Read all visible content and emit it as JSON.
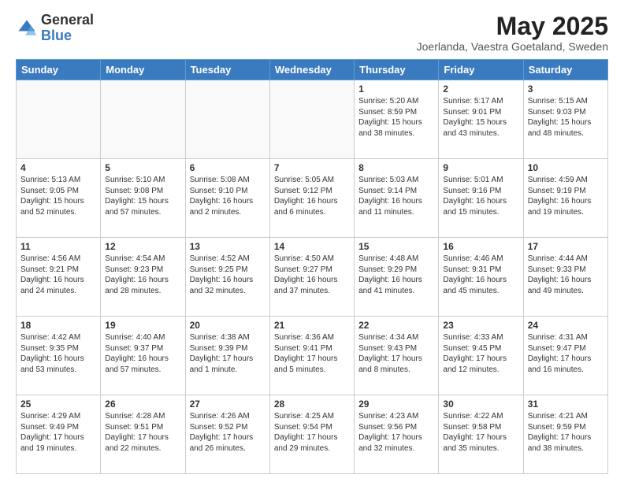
{
  "header": {
    "logo_general": "General",
    "logo_blue": "Blue",
    "month_year": "May 2025",
    "location": "Joerlanda, Vaestra Goetaland, Sweden"
  },
  "days_of_week": [
    "Sunday",
    "Monday",
    "Tuesday",
    "Wednesday",
    "Thursday",
    "Friday",
    "Saturday"
  ],
  "weeks": [
    [
      {
        "day": "",
        "info": ""
      },
      {
        "day": "",
        "info": ""
      },
      {
        "day": "",
        "info": ""
      },
      {
        "day": "",
        "info": ""
      },
      {
        "day": "1",
        "info": "Sunrise: 5:20 AM\nSunset: 8:59 PM\nDaylight: 15 hours\nand 38 minutes."
      },
      {
        "day": "2",
        "info": "Sunrise: 5:17 AM\nSunset: 9:01 PM\nDaylight: 15 hours\nand 43 minutes."
      },
      {
        "day": "3",
        "info": "Sunrise: 5:15 AM\nSunset: 9:03 PM\nDaylight: 15 hours\nand 48 minutes."
      }
    ],
    [
      {
        "day": "4",
        "info": "Sunrise: 5:13 AM\nSunset: 9:05 PM\nDaylight: 15 hours\nand 52 minutes."
      },
      {
        "day": "5",
        "info": "Sunrise: 5:10 AM\nSunset: 9:08 PM\nDaylight: 15 hours\nand 57 minutes."
      },
      {
        "day": "6",
        "info": "Sunrise: 5:08 AM\nSunset: 9:10 PM\nDaylight: 16 hours\nand 2 minutes."
      },
      {
        "day": "7",
        "info": "Sunrise: 5:05 AM\nSunset: 9:12 PM\nDaylight: 16 hours\nand 6 minutes."
      },
      {
        "day": "8",
        "info": "Sunrise: 5:03 AM\nSunset: 9:14 PM\nDaylight: 16 hours\nand 11 minutes."
      },
      {
        "day": "9",
        "info": "Sunrise: 5:01 AM\nSunset: 9:16 PM\nDaylight: 16 hours\nand 15 minutes."
      },
      {
        "day": "10",
        "info": "Sunrise: 4:59 AM\nSunset: 9:19 PM\nDaylight: 16 hours\nand 19 minutes."
      }
    ],
    [
      {
        "day": "11",
        "info": "Sunrise: 4:56 AM\nSunset: 9:21 PM\nDaylight: 16 hours\nand 24 minutes."
      },
      {
        "day": "12",
        "info": "Sunrise: 4:54 AM\nSunset: 9:23 PM\nDaylight: 16 hours\nand 28 minutes."
      },
      {
        "day": "13",
        "info": "Sunrise: 4:52 AM\nSunset: 9:25 PM\nDaylight: 16 hours\nand 32 minutes."
      },
      {
        "day": "14",
        "info": "Sunrise: 4:50 AM\nSunset: 9:27 PM\nDaylight: 16 hours\nand 37 minutes."
      },
      {
        "day": "15",
        "info": "Sunrise: 4:48 AM\nSunset: 9:29 PM\nDaylight: 16 hours\nand 41 minutes."
      },
      {
        "day": "16",
        "info": "Sunrise: 4:46 AM\nSunset: 9:31 PM\nDaylight: 16 hours\nand 45 minutes."
      },
      {
        "day": "17",
        "info": "Sunrise: 4:44 AM\nSunset: 9:33 PM\nDaylight: 16 hours\nand 49 minutes."
      }
    ],
    [
      {
        "day": "18",
        "info": "Sunrise: 4:42 AM\nSunset: 9:35 PM\nDaylight: 16 hours\nand 53 minutes."
      },
      {
        "day": "19",
        "info": "Sunrise: 4:40 AM\nSunset: 9:37 PM\nDaylight: 16 hours\nand 57 minutes."
      },
      {
        "day": "20",
        "info": "Sunrise: 4:38 AM\nSunset: 9:39 PM\nDaylight: 17 hours\nand 1 minute."
      },
      {
        "day": "21",
        "info": "Sunrise: 4:36 AM\nSunset: 9:41 PM\nDaylight: 17 hours\nand 5 minutes."
      },
      {
        "day": "22",
        "info": "Sunrise: 4:34 AM\nSunset: 9:43 PM\nDaylight: 17 hours\nand 8 minutes."
      },
      {
        "day": "23",
        "info": "Sunrise: 4:33 AM\nSunset: 9:45 PM\nDaylight: 17 hours\nand 12 minutes."
      },
      {
        "day": "24",
        "info": "Sunrise: 4:31 AM\nSunset: 9:47 PM\nDaylight: 17 hours\nand 16 minutes."
      }
    ],
    [
      {
        "day": "25",
        "info": "Sunrise: 4:29 AM\nSunset: 9:49 PM\nDaylight: 17 hours\nand 19 minutes."
      },
      {
        "day": "26",
        "info": "Sunrise: 4:28 AM\nSunset: 9:51 PM\nDaylight: 17 hours\nand 22 minutes."
      },
      {
        "day": "27",
        "info": "Sunrise: 4:26 AM\nSunset: 9:52 PM\nDaylight: 17 hours\nand 26 minutes."
      },
      {
        "day": "28",
        "info": "Sunrise: 4:25 AM\nSunset: 9:54 PM\nDaylight: 17 hours\nand 29 minutes."
      },
      {
        "day": "29",
        "info": "Sunrise: 4:23 AM\nSunset: 9:56 PM\nDaylight: 17 hours\nand 32 minutes."
      },
      {
        "day": "30",
        "info": "Sunrise: 4:22 AM\nSunset: 9:58 PM\nDaylight: 17 hours\nand 35 minutes."
      },
      {
        "day": "31",
        "info": "Sunrise: 4:21 AM\nSunset: 9:59 PM\nDaylight: 17 hours\nand 38 minutes."
      }
    ]
  ]
}
